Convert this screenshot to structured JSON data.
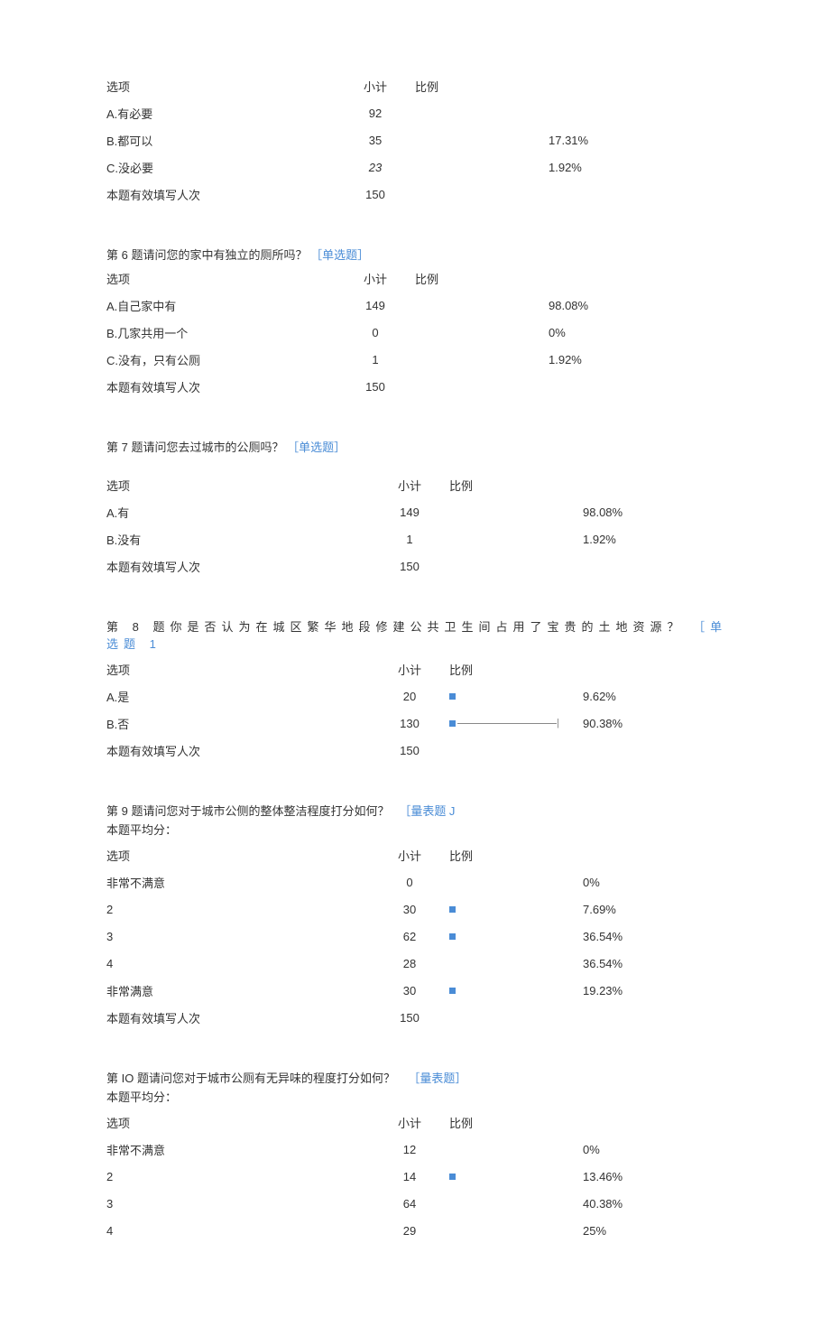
{
  "hdr": {
    "opt": "选项",
    "cnt": "小计",
    "ratio": "比例",
    "total": "本题有效填写人次"
  },
  "q5": {
    "rows": [
      {
        "label": "A.有必要",
        "count": "92",
        "pct": ""
      },
      {
        "label": "B.都可以",
        "count": "35",
        "pct": "17.31%"
      },
      {
        "label": "C.没必要",
        "count": "23",
        "pct": "1.92%"
      }
    ],
    "total": "150"
  },
  "q6": {
    "title": "第 6 题请问您的家中有独立的厕所吗？",
    "tag": "［单选题］",
    "rows": [
      {
        "label": "A.自己家中有",
        "count": "149",
        "pct": "98.08%"
      },
      {
        "label": "B.几家共用一个",
        "count": "0",
        "pct": "0%"
      },
      {
        "label": "C.没有，只有公厕",
        "count": "1",
        "pct": "1.92%"
      }
    ],
    "total": "150"
  },
  "q7": {
    "title": "第 7 题请问您去过城市的公厕吗？",
    "tag": "［单选题］",
    "rows": [
      {
        "label": "A.有",
        "count": "149",
        "pct": "98.08%"
      },
      {
        "label": "B.没有",
        "count": "1",
        "pct": "1.92%"
      }
    ],
    "total": "150"
  },
  "q8": {
    "title": "第 8 题你是否认为在城区繁华地段修建公共卫生间占用了宝贵的土地资源？",
    "tag": "［单选题 1",
    "rows": [
      {
        "label": "A.是",
        "count": "20",
        "pct": "9.62%",
        "bar": true
      },
      {
        "label": "B.否",
        "count": "130",
        "pct": "90.38%",
        "bar": true,
        "line": true
      }
    ],
    "total": "150"
  },
  "q9": {
    "title": "第 9 题请问您对于城市公侧的整体整洁程度打分如何？",
    "tag": "［量表题 J",
    "avg": "本题平均分：",
    "rows": [
      {
        "label": "非常不满意",
        "count": "0",
        "pct": "0%"
      },
      {
        "label": "2",
        "count": "30",
        "pct": "7.69%",
        "bar": true
      },
      {
        "label": "3",
        "count": "62",
        "pct": "36.54%",
        "bar": true
      },
      {
        "label": "4",
        "count": "28",
        "pct": "36.54%"
      },
      {
        "label": "非常满意",
        "count": "30",
        "pct": "19.23%",
        "bar": true
      }
    ],
    "total": "150"
  },
  "q10": {
    "title": "第 IO 题请问您对于城市公厕有无异味的程度打分如何？",
    "tag": "［量表题］",
    "avg": "本题平均分：",
    "rows": [
      {
        "label": "非常不满意",
        "count": "12",
        "pct": "0%"
      },
      {
        "label": "2",
        "count": "14",
        "pct": "13.46%",
        "bar": true
      },
      {
        "label": "3",
        "count": "64",
        "pct": "40.38%"
      },
      {
        "label": "4",
        "count": "29",
        "pct": "25%"
      }
    ]
  },
  "chart_data": [
    {
      "type": "table",
      "question": "Q5",
      "categories": [
        "A.有必要",
        "B.都可以",
        "C.没必要"
      ],
      "values": [
        92,
        35,
        23
      ],
      "percents": [
        null,
        17.31,
        1.92
      ],
      "n": 150
    },
    {
      "type": "table",
      "question": "Q6",
      "categories": [
        "A.自己家中有",
        "B.几家共用一个",
        "C.没有，只有公厕"
      ],
      "values": [
        149,
        0,
        1
      ],
      "percents": [
        98.08,
        0,
        1.92
      ],
      "n": 150
    },
    {
      "type": "table",
      "question": "Q7",
      "categories": [
        "A.有",
        "B.没有"
      ],
      "values": [
        149,
        1
      ],
      "percents": [
        98.08,
        1.92
      ],
      "n": 150
    },
    {
      "type": "bar",
      "question": "Q8",
      "categories": [
        "A.是",
        "B.否"
      ],
      "values": [
        20,
        130
      ],
      "percents": [
        9.62,
        90.38
      ],
      "n": 150
    },
    {
      "type": "bar",
      "question": "Q9",
      "categories": [
        "非常不满意",
        "2",
        "3",
        "4",
        "非常满意"
      ],
      "values": [
        0,
        30,
        62,
        28,
        30
      ],
      "percents": [
        0,
        7.69,
        36.54,
        36.54,
        19.23
      ],
      "n": 150
    },
    {
      "type": "bar",
      "question": "Q10",
      "categories": [
        "非常不满意",
        "2",
        "3",
        "4"
      ],
      "values": [
        12,
        14,
        64,
        29
      ],
      "percents": [
        0,
        13.46,
        40.38,
        25
      ]
    }
  ]
}
